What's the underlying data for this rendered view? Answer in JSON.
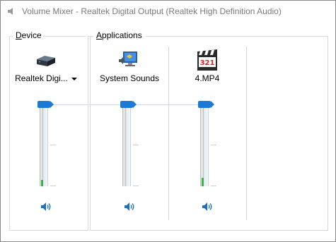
{
  "window": {
    "title": "Volume Mixer - Realtek Digital Output (Realtek High Definition Audio)"
  },
  "groups": {
    "device_label": "Device",
    "device_accesskey": "D",
    "apps_label": "Applications",
    "apps_accesskey": "A"
  },
  "channels": [
    {
      "label": "Realtek Digi...",
      "icon": "speaker-device-icon",
      "has_dropdown": true,
      "volume_percent": 100,
      "peak_percent": 8
    },
    {
      "label": "System Sounds",
      "icon": "system-sounds-icon",
      "has_dropdown": false,
      "volume_percent": 100,
      "peak_percent": 0
    },
    {
      "label": "4.MP4",
      "icon": "media-player-icon",
      "has_dropdown": false,
      "volume_percent": 100,
      "peak_percent": 10
    }
  ],
  "colors": {
    "thumb": "#1a7ad6",
    "peak": "#39b54a",
    "title_text": "#7a7a7a"
  }
}
